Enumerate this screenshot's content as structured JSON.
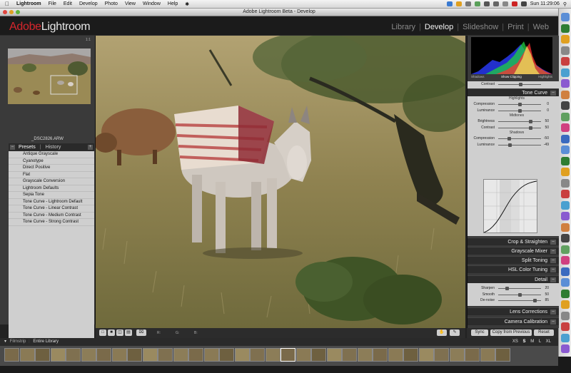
{
  "menubar": {
    "apple": "",
    "items": [
      "Lightroom",
      "File",
      "Edit",
      "Develop",
      "Photo",
      "View",
      "Window",
      "Help"
    ],
    "clock": "Sun 11:29:06"
  },
  "window": {
    "title": "Adobe Lightroom Beta - Develop"
  },
  "identity": {
    "logo_adobe": "Adobe",
    "logo_name": "Lightroom",
    "modules": [
      "Library",
      "Develop",
      "Slideshow",
      "Print",
      "Web"
    ],
    "active_module": "Develop"
  },
  "left": {
    "navigator_zoom": "1:1",
    "filename": "_DSC2826.ARW",
    "tabs": {
      "presets": "Presets",
      "history": "History"
    },
    "add_symbol": "+",
    "collapse_symbol": "–",
    "presets": [
      "Antique Grayscale",
      "Cyanotype",
      "Direct Positive",
      "Flat",
      "Grayscale Conversion",
      "Lightroom Defaults",
      "Sepia Tone",
      "Tone Curve - Lightroom Default",
      "Tone Curve - Linear Contrast",
      "Tone Curve - Medium Contrast",
      "Tone Curve - Strong Contrast"
    ]
  },
  "histogram": {
    "shadows": "Shadows",
    "clipping": "Show Clipping",
    "highlights": "Highlights"
  },
  "right": {
    "contrast_top": {
      "label": "Contrast",
      "value": ""
    },
    "tone_curve": {
      "title": "Tone Curve",
      "highlights_label": "Highlights",
      "midtones_label": "Midtones",
      "shadows_label": "Shadows",
      "sliders": [
        {
          "label": "Compression",
          "value": "0",
          "pos": 0.5
        },
        {
          "label": "Luminance",
          "value": "0",
          "pos": 0.5
        },
        {
          "label": "Brightness",
          "value": "50",
          "pos": 0.75
        },
        {
          "label": "Contrast",
          "value": "50",
          "pos": 0.75
        },
        {
          "label": "Compression",
          "value": "-50",
          "pos": 0.25
        },
        {
          "label": "Luminance",
          "value": "-49",
          "pos": 0.26
        }
      ]
    },
    "sections": [
      "Crop & Straighten",
      "Grayscale Mixer",
      "Split Toning",
      "HSL Color Tuning"
    ],
    "detail": {
      "title": "Detail",
      "sliders": [
        {
          "label": "Sharpen",
          "value": "20",
          "pos": 0.2
        },
        {
          "label": "Smooth",
          "value": "50",
          "pos": 0.5
        },
        {
          "label": "De-noise",
          "value": "85",
          "pos": 0.85
        }
      ]
    },
    "bottom_sections": [
      "Lens Corrections",
      "Camera Calibration"
    ],
    "buttons": {
      "sync": "Sync",
      "copy": "Copy from Previous",
      "reset": "Reset"
    }
  },
  "toolbar": {
    "r": "R:",
    "g": "G:",
    "b": "B:"
  },
  "filmstrip": {
    "label": "Filmstrip",
    "source": "Entire Library",
    "sizes": [
      "XS",
      "S",
      "M",
      "L",
      "XL"
    ]
  }
}
